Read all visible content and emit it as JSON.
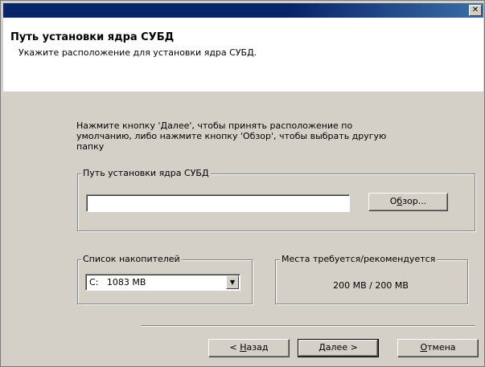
{
  "window": {
    "close_glyph": "✕"
  },
  "header": {
    "title": "Путь установки ядра СУБД",
    "subtitle": "Укажите расположение для установки ядра СУБД."
  },
  "body": {
    "instructions": "Нажмите кнопку 'Далее', чтобы принять расположение по умолчанию, либо нажмите кнопку 'Обзор', чтобы выбрать другую папку"
  },
  "install_path_group": {
    "label": "Путь установки ядра СУБД",
    "path_value": "",
    "browse_button": {
      "prefix": "О",
      "underlined": "б",
      "suffix": "зор..."
    }
  },
  "drives_group": {
    "label": "Список накопителей",
    "selected": "C:   1083 MB"
  },
  "space_group": {
    "label": "Места требуется/рекомендуется",
    "value": "200 MB / 200 MB"
  },
  "buttons": {
    "back": {
      "prefix": "< ",
      "underlined": "Н",
      "suffix": "азад"
    },
    "next": {
      "prefix": "",
      "underlined": "Д",
      "suffix": "алее >"
    },
    "cancel": {
      "prefix": "",
      "underlined": "О",
      "suffix": "тмена"
    }
  },
  "icons": {
    "close": "close-icon",
    "dropdown": "chevron-down-icon"
  }
}
